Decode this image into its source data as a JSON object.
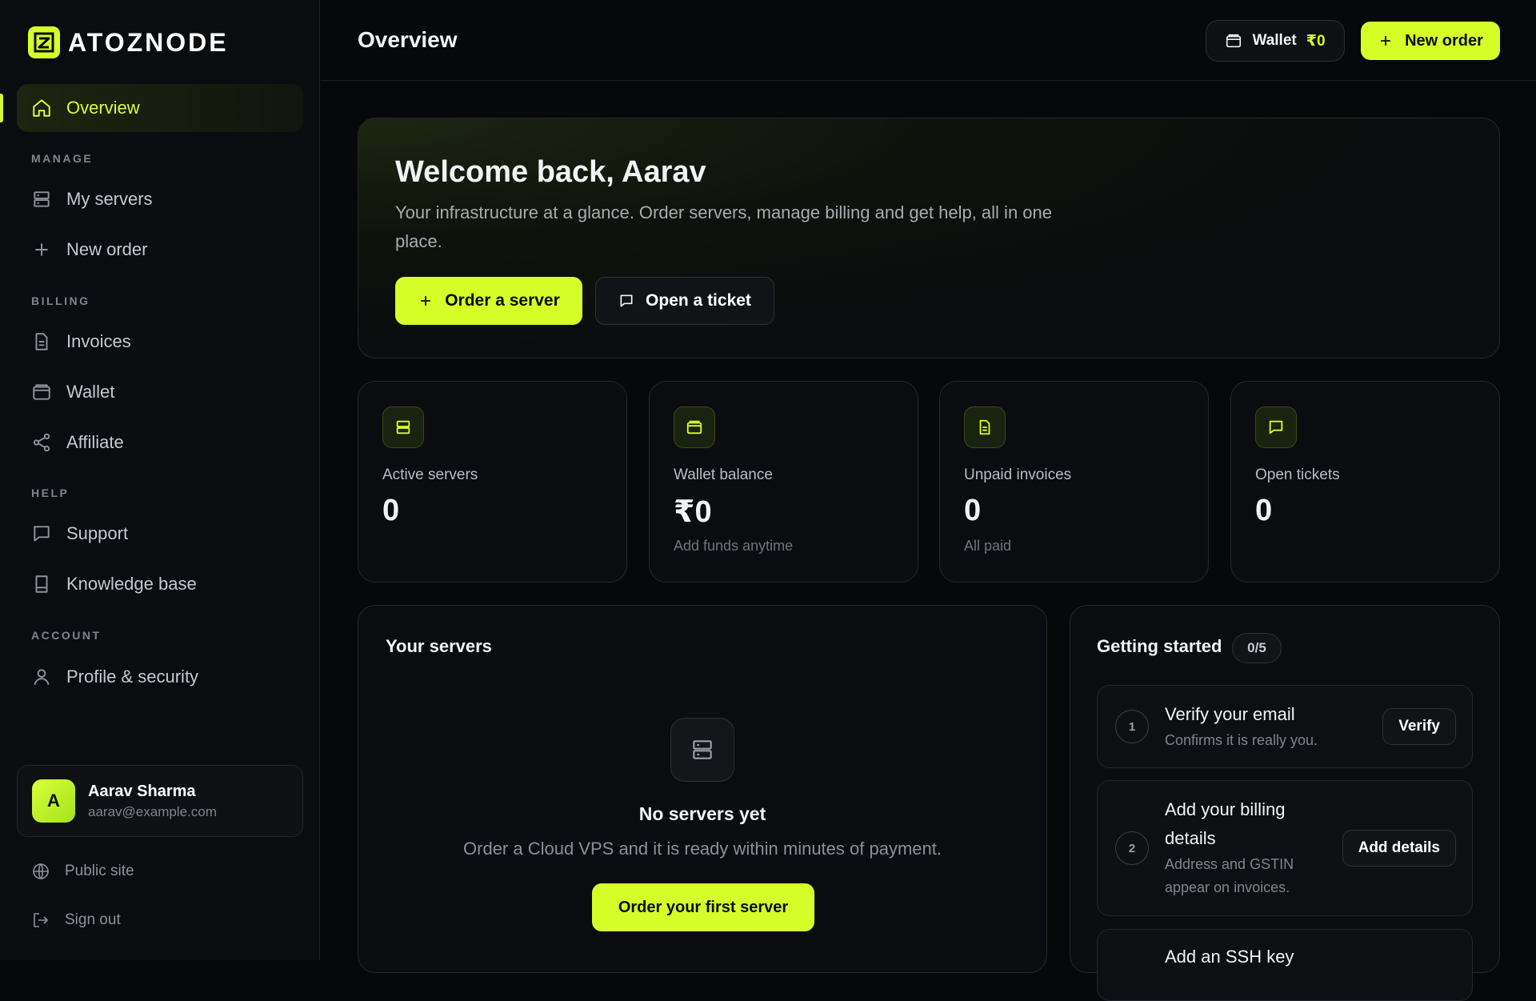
{
  "brand": {
    "name": "ATOZNODE",
    "accent": "#d6ff2a"
  },
  "sidebar": {
    "overview": "Overview",
    "sections": {
      "manage": "MANAGE",
      "billing": "BILLING",
      "help": "HELP",
      "account": "ACCOUNT"
    },
    "items": {
      "my_servers": "My servers",
      "new_order": "New order",
      "invoices": "Invoices",
      "wallet": "Wallet",
      "affiliate": "Affiliate",
      "support": "Support",
      "knowledge_base": "Knowledge base",
      "profile": "Profile & security"
    },
    "user": {
      "initial": "A",
      "name": "Aarav Sharma",
      "email": "aarav@example.com"
    },
    "footer": {
      "public_site": "Public site",
      "sign_out": "Sign out"
    }
  },
  "header": {
    "title": "Overview",
    "wallet_label": "Wallet",
    "wallet_amount": "₹0",
    "new_order": "New order"
  },
  "hero": {
    "title": "Welcome back, Aarav",
    "text": "Your infrastructure at a glance. Order servers, manage billing and get help, all in one place.",
    "primary_button": "Order a server",
    "secondary_button": "Open a ticket"
  },
  "stats": [
    {
      "label": "Active servers",
      "value": "0",
      "sub": "",
      "icon": "server-icon"
    },
    {
      "label": "Wallet balance",
      "value": "₹0",
      "sub": "Add funds anytime",
      "icon": "wallet-icon"
    },
    {
      "label": "Unpaid invoices",
      "value": "0",
      "sub": "All paid",
      "icon": "invoice-icon"
    },
    {
      "label": "Open tickets",
      "value": "0",
      "sub": "",
      "icon": "chat-icon"
    }
  ],
  "servers": {
    "title": "Your servers",
    "empty_title": "No servers yet",
    "empty_text": "Order a Cloud VPS and it is ready within minutes of payment.",
    "button": "Order your first server"
  },
  "getting_started": {
    "title": "Getting started",
    "progress": "0/5",
    "steps": [
      {
        "num": "1",
        "title": "Verify your email",
        "desc": "Confirms it is really you.",
        "button": "Verify"
      },
      {
        "num": "2",
        "title": "Add your billing details",
        "desc": "Address and GSTIN appear on invoices.",
        "button": "Add details"
      },
      {
        "num": "3",
        "title": "Add an SSH key",
        "desc": "",
        "button": ""
      }
    ]
  }
}
